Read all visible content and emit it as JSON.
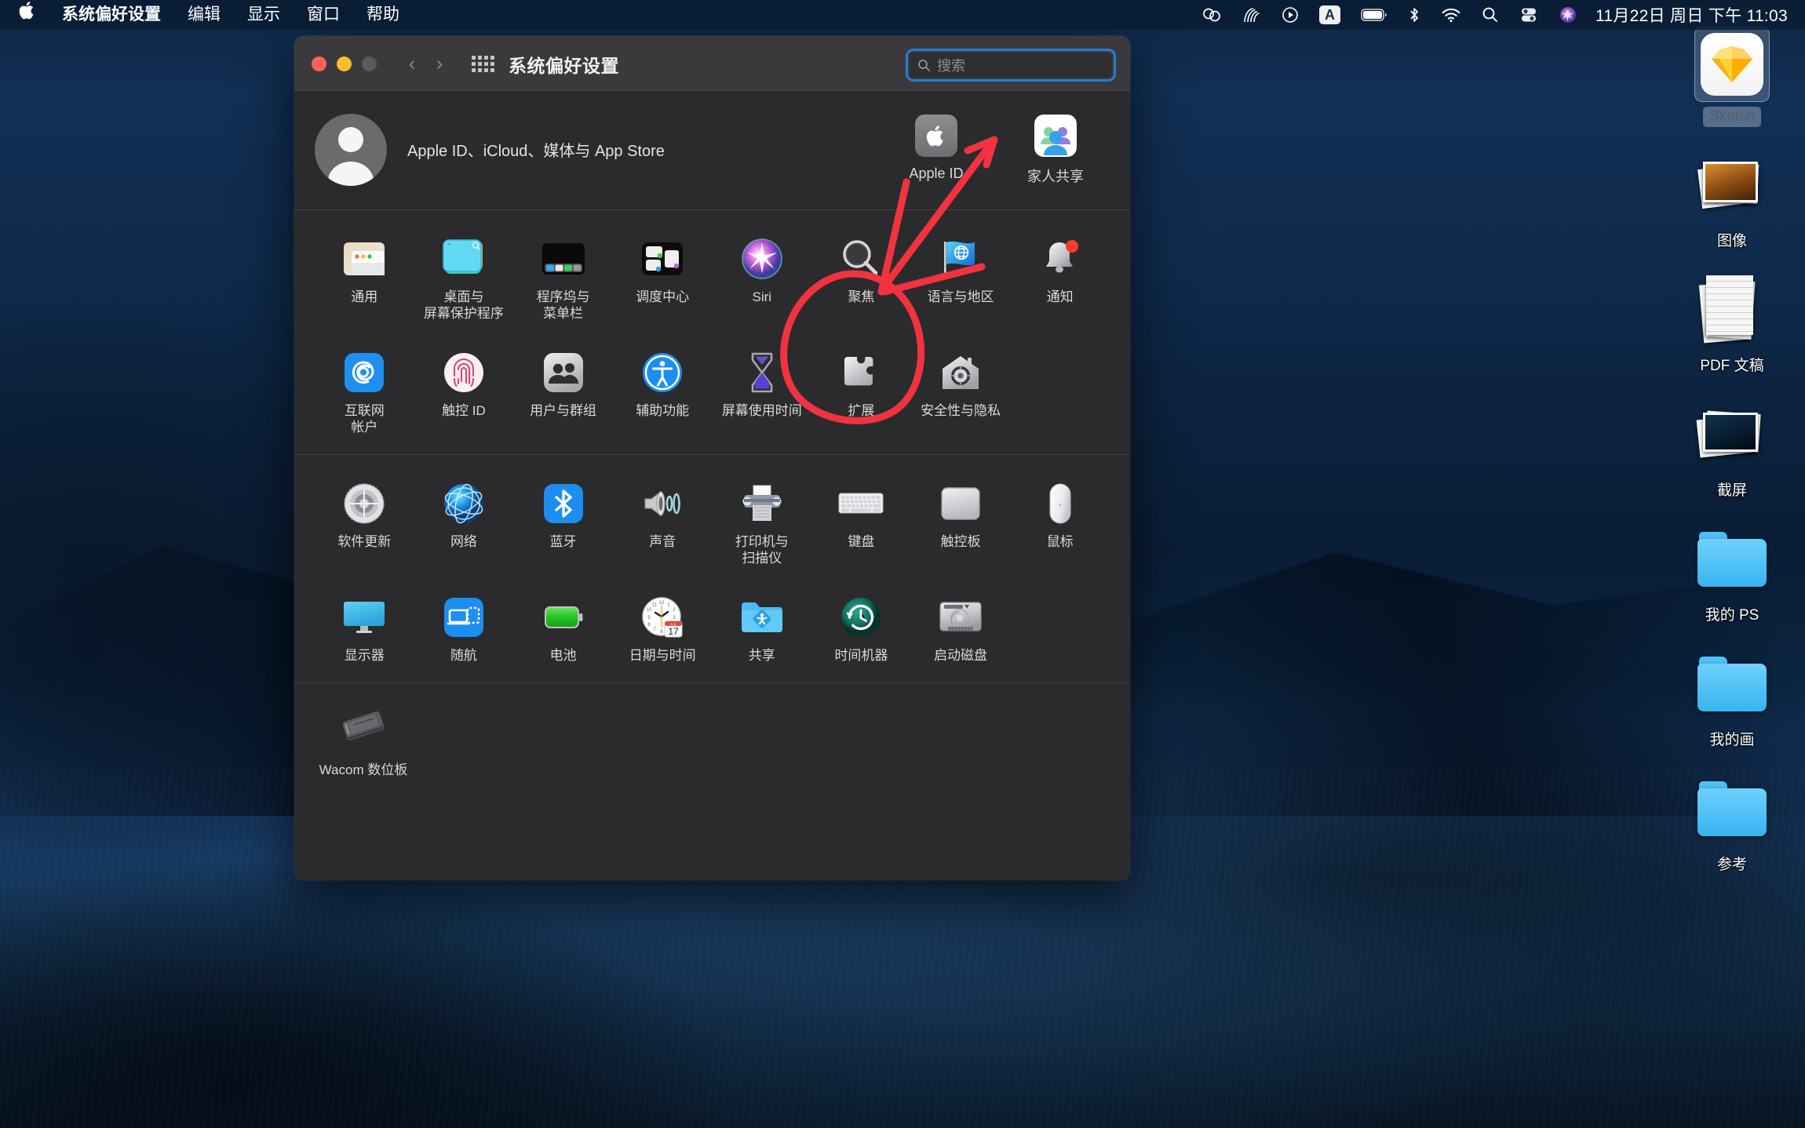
{
  "menubar": {
    "apple_icon": "apple-logo-icon",
    "items": [
      {
        "label": "系统偏好设置",
        "bold": true
      },
      {
        "label": "编辑",
        "bold": false
      },
      {
        "label": "显示",
        "bold": false
      },
      {
        "label": "窗口",
        "bold": false
      },
      {
        "label": "帮助",
        "bold": false
      }
    ],
    "status_icons": [
      "creative-cloud-icon",
      "wacom-icon",
      "play-circle-icon",
      "text-input-a-icon",
      "battery-icon",
      "bluetooth-icon",
      "wifi-icon",
      "spotlight-search-icon",
      "control-center-icon",
      "siri-icon"
    ],
    "clock": "11月22日 周日 下午 11:03"
  },
  "desktop": {
    "icons": [
      {
        "label": "Sketch",
        "icon": "sketch-app-icon",
        "selected": true
      },
      {
        "label": "图像",
        "icon": "photos-stack-icon",
        "selected": false
      },
      {
        "label": "PDF 文稿",
        "icon": "pdf-documents-icon",
        "selected": false
      },
      {
        "label": "截屏",
        "icon": "screenshots-stack-icon",
        "selected": false
      },
      {
        "label": "我的 PS",
        "icon": "folder-icon",
        "selected": false
      },
      {
        "label": "我的画",
        "icon": "folder-icon",
        "selected": false
      },
      {
        "label": "参考",
        "icon": "folder-icon",
        "selected": false
      }
    ]
  },
  "window": {
    "title": "系统偏好设置",
    "traffic_lights": [
      "close-button",
      "minimize-button",
      "zoom-button"
    ],
    "back_label": "‹",
    "forward_label": "›",
    "grid_button": "show-all-grid-icon",
    "search": {
      "placeholder": "搜索",
      "value": "",
      "focused": true,
      "icon": "search-icon"
    }
  },
  "apple_id_row": {
    "avatar": "default-user-avatar",
    "text": "Apple ID、iCloud、媒体与 App Store",
    "tiles": [
      {
        "label": "Apple ID",
        "icon": "apple-id-icon"
      },
      {
        "label": "家人共享",
        "icon": "family-sharing-icon"
      }
    ]
  },
  "sections": [
    {
      "name": "personal",
      "items": [
        {
          "label": "通用",
          "icon": "general-icon"
        },
        {
          "label": "桌面与\n屏幕保护程序",
          "icon": "desktop-screensaver-icon"
        },
        {
          "label": "程序坞与\n菜单栏",
          "icon": "dock-menubar-icon",
          "highlighted": true
        },
        {
          "label": "调度中心",
          "icon": "mission-control-icon"
        },
        {
          "label": "Siri",
          "icon": "siri-icon"
        },
        {
          "label": "聚焦",
          "icon": "spotlight-icon"
        },
        {
          "label": "语言与地区",
          "icon": "language-region-icon"
        },
        {
          "label": "通知",
          "icon": "notifications-icon",
          "badge": true
        },
        {
          "label": "互联网\n帐户",
          "icon": "internet-accounts-icon"
        },
        {
          "label": "触控 ID",
          "icon": "touch-id-icon"
        },
        {
          "label": "用户与群组",
          "icon": "users-groups-icon"
        },
        {
          "label": "辅助功能",
          "icon": "accessibility-icon"
        },
        {
          "label": "屏幕使用时间",
          "icon": "screen-time-icon"
        },
        {
          "label": "扩展",
          "icon": "extensions-icon"
        },
        {
          "label": "安全性与隐私",
          "icon": "security-privacy-icon"
        }
      ]
    },
    {
      "name": "hardware",
      "items": [
        {
          "label": "软件更新",
          "icon": "software-update-icon"
        },
        {
          "label": "网络",
          "icon": "network-icon"
        },
        {
          "label": "蓝牙",
          "icon": "bluetooth-icon"
        },
        {
          "label": "声音",
          "icon": "sound-icon"
        },
        {
          "label": "打印机与\n扫描仪",
          "icon": "printers-scanners-icon"
        },
        {
          "label": "键盘",
          "icon": "keyboard-icon"
        },
        {
          "label": "触控板",
          "icon": "trackpad-icon"
        },
        {
          "label": "鼠标",
          "icon": "mouse-icon"
        },
        {
          "label": "显示器",
          "icon": "displays-icon"
        },
        {
          "label": "随航",
          "icon": "sidecar-icon"
        },
        {
          "label": "电池",
          "icon": "battery-icon"
        },
        {
          "label": "日期与时间",
          "icon": "date-time-icon"
        },
        {
          "label": "共享",
          "icon": "sharing-icon"
        },
        {
          "label": "时间机器",
          "icon": "time-machine-icon"
        },
        {
          "label": "启动磁盘",
          "icon": "startup-disk-icon"
        }
      ]
    },
    {
      "name": "third-party",
      "items": [
        {
          "label": "Wacom 数位板",
          "icon": "wacom-tablet-icon"
        }
      ]
    }
  ],
  "annotation": {
    "color": "#f2333f",
    "shapes": [
      "oval-highlight-around-dock-menubar",
      "arrow-pointing-up-right"
    ]
  }
}
